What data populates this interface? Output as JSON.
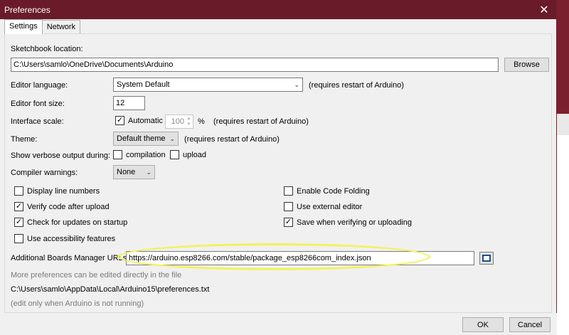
{
  "window": {
    "title": "Preferences",
    "close_glyph": "✕"
  },
  "tabs": [
    {
      "label": "Settings",
      "active": true
    },
    {
      "label": "Network",
      "active": false
    }
  ],
  "sketchbook": {
    "label": "Sketchbook location:",
    "value": "C:\\Users\\samlo\\OneDrive\\Documents\\Arduino",
    "browse": "Browse"
  },
  "editor_language": {
    "label": "Editor language:",
    "value": "System Default",
    "note": "(requires restart of Arduino)"
  },
  "editor_font_size": {
    "label": "Editor font size:",
    "value": "12"
  },
  "interface_scale": {
    "label": "Interface scale:",
    "auto_label": "Automatic",
    "auto_checked": true,
    "value": "100",
    "unit": "%",
    "note": "(requires restart of Arduino)"
  },
  "theme": {
    "label": "Theme:",
    "value": "Default theme",
    "note": "(requires restart of Arduino)"
  },
  "verbose": {
    "label": "Show verbose output during:",
    "compilation": "compilation",
    "upload": "upload"
  },
  "compiler_warnings": {
    "label": "Compiler warnings:",
    "value": "None"
  },
  "options_left": [
    {
      "label": "Display line numbers",
      "checked": false
    },
    {
      "label": "Verify code after upload",
      "checked": true
    },
    {
      "label": "Check for updates on startup",
      "checked": true
    },
    {
      "label": "Use accessibility features",
      "checked": false
    }
  ],
  "options_right": [
    {
      "label": "Enable Code Folding",
      "checked": false
    },
    {
      "label": "Use external editor",
      "checked": false
    },
    {
      "label": "Save when verifying or uploading",
      "checked": true
    }
  ],
  "boards_urls": {
    "label": "Additional Boards Manager URLs:",
    "value": "https://arduino.esp8266.com/stable/package_esp8266com_index.json"
  },
  "more_prefs": "More preferences can be edited directly in the file",
  "prefs_path": "C:\\Users\\samlo\\AppData\\Local\\Arduino15\\preferences.txt",
  "edit_note": "(edit only when Arduino is not running)",
  "footer": {
    "ok": "OK",
    "cancel": "Cancel"
  },
  "colors": {
    "titlebar": "#6a1b29",
    "highlight": "#f2f25a"
  },
  "icons": {
    "close": "close-icon",
    "check": "check-icon",
    "dropdown": "chevron-down-icon",
    "url_editor": "window-icon"
  }
}
